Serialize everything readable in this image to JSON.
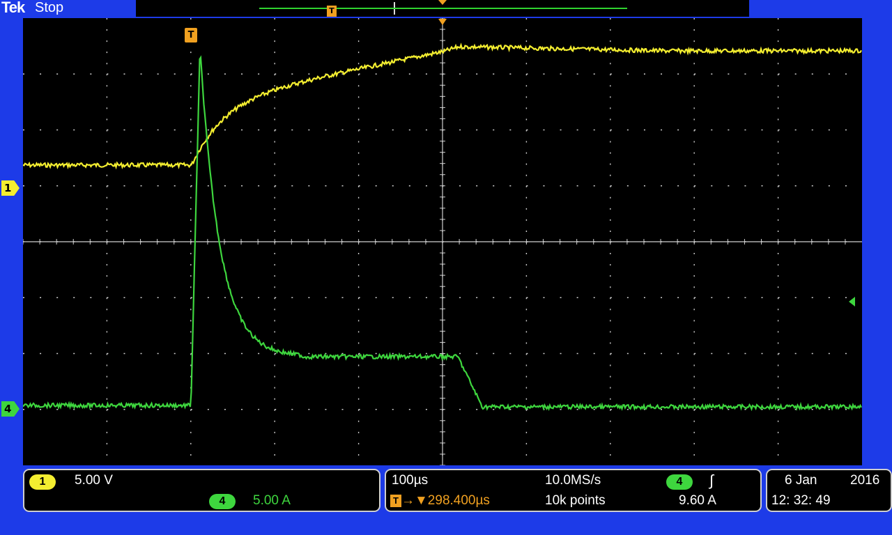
{
  "header": {
    "brand": "Tek",
    "run_state": "Stop",
    "trigger_label": "T"
  },
  "channels": {
    "ch1": {
      "marker": "1",
      "scale": "5.00 V",
      "color": "#f4ee30"
    },
    "ch4": {
      "marker": "4",
      "scale": "5.00 A",
      "color": "#3ed63e"
    }
  },
  "horizontal": {
    "timebase": "100µs",
    "sample_rate": "10.0MS/s",
    "trigger_position_label": "T",
    "trigger_position": "→▼298.400µs",
    "record_length": "10k points"
  },
  "trigger": {
    "source": "4",
    "slope_icon": "rising-edge-icon",
    "slope_glyph": "∫",
    "level": "9.60 A"
  },
  "clock": {
    "date_day_month": "6 Jan",
    "year": "2016",
    "time": "12: 32: 49"
  },
  "colors": {
    "background": "#1d3be8",
    "screen": "#000000",
    "trigger_orange": "#f0a020",
    "grid": "#cfcfcf"
  }
}
